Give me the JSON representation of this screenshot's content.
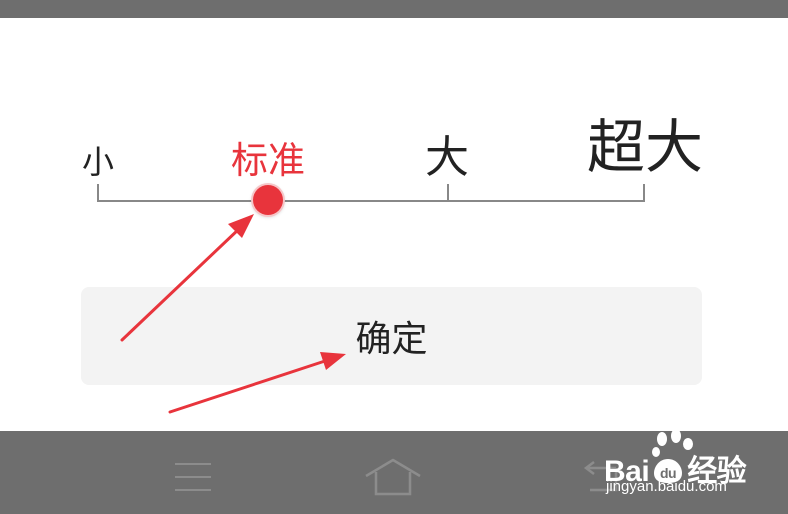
{
  "font_size_slider": {
    "labels": [
      "小",
      "标准",
      "大",
      "超大"
    ],
    "selected_label": "标准",
    "selected_index": 1,
    "accent_color": "#e8343c"
  },
  "dialog": {
    "confirm_label": "确定"
  },
  "nav_bar": {
    "icons": [
      "menu-icon",
      "home-icon",
      "back-icon"
    ]
  },
  "watermark": {
    "brand_prefix": "Bai",
    "brand_suffix": "经验",
    "url": "jingyan.baidu.com"
  },
  "annotations": {
    "arrow_color": "#e8343c"
  }
}
